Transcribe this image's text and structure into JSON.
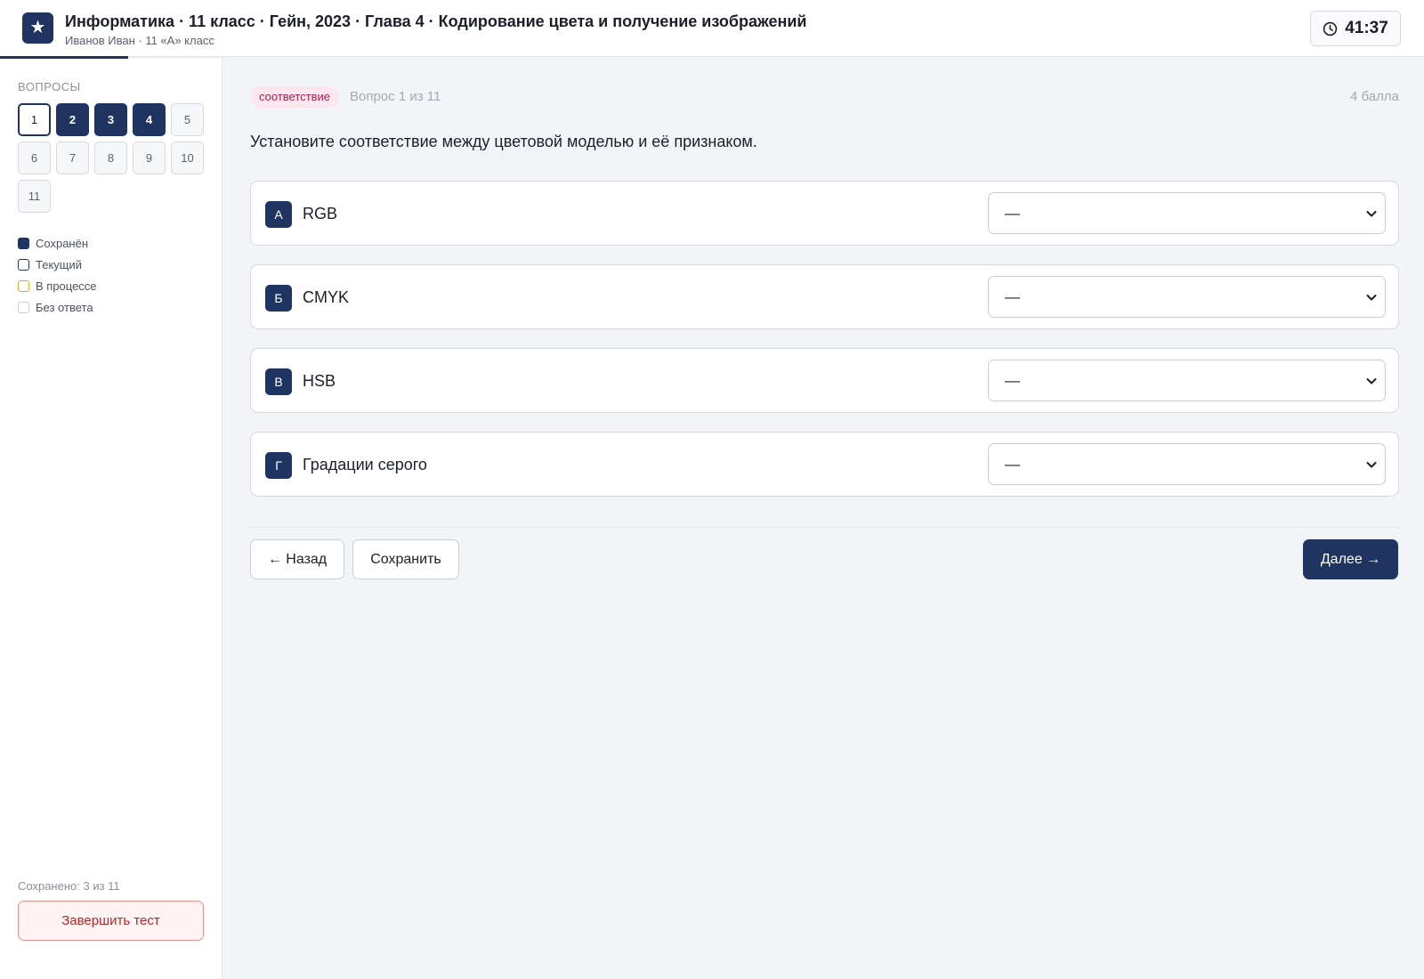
{
  "header": {
    "logo_icon": "star-icon",
    "logo_glyph": "★",
    "title": "Информатика · 11 класс · Гейн, 2023 · Глава 4 · Кодирование цвета и получение изображений",
    "subtitle": "Иванов Иван · 11 «А» класс",
    "timer_icon": "clock-icon",
    "timer": "41:37"
  },
  "sidebar": {
    "section_title": "Вопросы",
    "questions": [
      {
        "label": "1",
        "state": "current"
      },
      {
        "label": "2",
        "state": "saved"
      },
      {
        "label": "3",
        "state": "saved"
      },
      {
        "label": "4",
        "state": "saved"
      },
      {
        "label": "5",
        "state": "none"
      },
      {
        "label": "6",
        "state": "none"
      },
      {
        "label": "7",
        "state": "none"
      },
      {
        "label": "8",
        "state": "none"
      },
      {
        "label": "9",
        "state": "none"
      },
      {
        "label": "10",
        "state": "none"
      },
      {
        "label": "11",
        "state": "none"
      }
    ],
    "legend": [
      {
        "label": "Сохранён",
        "state": "saved"
      },
      {
        "label": "Текущий",
        "state": "current"
      },
      {
        "label": "В процессе",
        "state": "progress"
      },
      {
        "label": "Без ответа",
        "state": "none"
      }
    ],
    "saved_count": "Сохранено: 3 из 11",
    "finish_label": "Завершить тест"
  },
  "main": {
    "tag": "соответствие",
    "question_number": "Вопрос 1 из 11",
    "points": "4 балла",
    "question": "Установите соответствие между цветовой моделью и её признаком.",
    "options": [
      {
        "letter": "А",
        "label": "RGB",
        "selected": "—"
      },
      {
        "letter": "Б",
        "label": "CMYK",
        "selected": "—"
      },
      {
        "letter": "В",
        "label": "HSB",
        "selected": "—"
      },
      {
        "letter": "Г",
        "label": "Градации серого",
        "selected": "—"
      }
    ],
    "back_label": "← Назад",
    "save_label": "Сохранить",
    "next_label": "Далее →"
  },
  "colors": {
    "accent": "#1f3461",
    "tag_bg": "#fbe7ee",
    "tag_text": "#a61e4d",
    "danger": "#b02828",
    "progress": "#e0a832"
  }
}
